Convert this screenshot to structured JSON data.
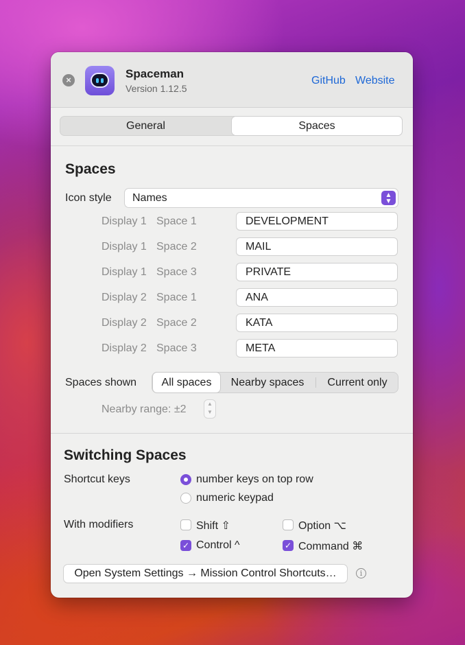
{
  "app": {
    "name": "Spaceman",
    "version": "Version 1.12.5"
  },
  "header": {
    "github_label": "GitHub",
    "website_label": "Website"
  },
  "tabs": [
    {
      "label": "General"
    },
    {
      "label": "Spaces"
    }
  ],
  "spaces": {
    "title": "Spaces",
    "icon_style_label": "Icon style",
    "icon_style_value": "Names",
    "rows": [
      {
        "display": "Display 1",
        "space": "Space 1",
        "name": "DEVELOPMENT"
      },
      {
        "display": "Display 1",
        "space": "Space 2",
        "name": "MAIL"
      },
      {
        "display": "Display 1",
        "space": "Space 3",
        "name": "PRIVATE"
      },
      {
        "display": "Display 2",
        "space": "Space 1",
        "name": "ANA"
      },
      {
        "display": "Display 2",
        "space": "Space 2",
        "name": "KATA"
      },
      {
        "display": "Display 2",
        "space": "Space 3",
        "name": "META"
      }
    ],
    "shown_label": "Spaces shown",
    "shown_options": [
      "All spaces",
      "Nearby spaces",
      "Current only"
    ],
    "nearby_range": "Nearby range: ±2"
  },
  "switching": {
    "title": "Switching Spaces",
    "shortcut_label": "Shortcut keys",
    "shortcut_options": [
      "number keys on top row",
      "numeric keypad"
    ],
    "modifiers_label": "With modifiers",
    "modifiers": {
      "shift": "Shift ⇧",
      "option": "Option ⌥",
      "control": "Control ^",
      "command": "Command ⌘"
    },
    "settings_button": "Open System Settings → Mission Control Shortcuts…"
  },
  "colors": {
    "accent": "#7a4fd9",
    "link": "#1e68d6"
  }
}
